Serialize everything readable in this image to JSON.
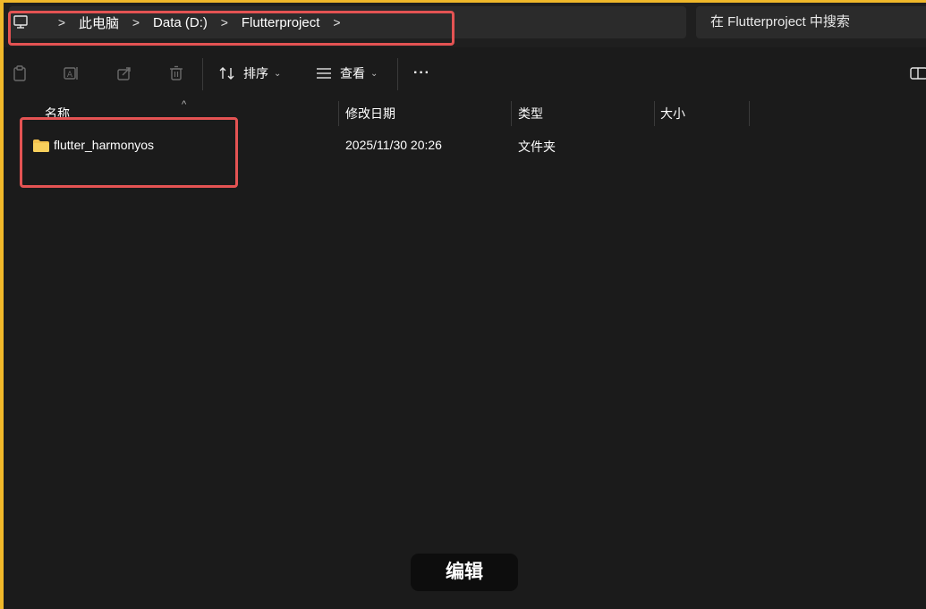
{
  "address_bar": {
    "crumbs": [
      "此电脑",
      "Data (D:)",
      "Flutterproject"
    ],
    "separator": ">"
  },
  "search": {
    "placeholder": "在 Flutterproject 中搜索"
  },
  "toolbar": {
    "sort_label": "排序",
    "view_label": "查看",
    "more_label": "···",
    "caret": "⌄"
  },
  "columns": {
    "name": "名称",
    "modified": "修改日期",
    "type": "类型",
    "size": "大小",
    "sort_indicator": "^"
  },
  "files": [
    {
      "name": "flutter_harmonyos",
      "modified": "2025/11/30 20:26",
      "type": "文件夹",
      "size": ""
    }
  ],
  "overlay": {
    "edit_label": "编辑"
  },
  "colors": {
    "highlight": "#e45353",
    "folder": "#f2c14e",
    "frame_border": "#f0b82a",
    "background": "#1b1b1b"
  }
}
